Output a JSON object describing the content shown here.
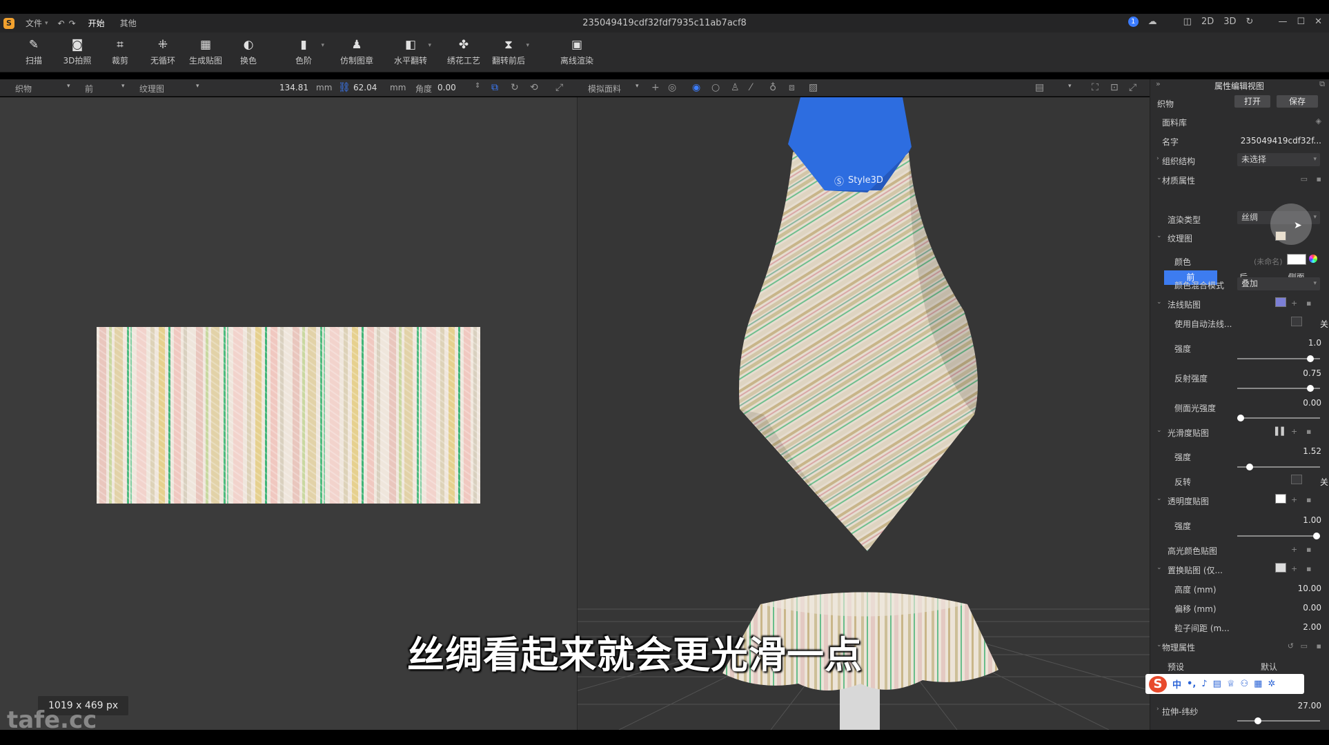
{
  "window": {
    "title": "235049419cdf32fdf7935c11ab7acf8",
    "menus": [
      "文件",
      "开始",
      "其他"
    ],
    "notification_count": "1",
    "view_modes": [
      "2D",
      "3D"
    ]
  },
  "toolbar": {
    "tools": [
      {
        "label": "扫描",
        "icon": "scan-icon"
      },
      {
        "label": "3D拍照",
        "icon": "camera-icon"
      },
      {
        "label": "裁剪",
        "icon": "crop-icon"
      },
      {
        "label": "无循环",
        "icon": "seamless-icon"
      },
      {
        "label": "生成贴图",
        "icon": "generate-map-icon"
      },
      {
        "label": "换色",
        "icon": "color-drop-icon"
      },
      {
        "label": "色阶",
        "icon": "levels-icon"
      },
      {
        "label": "仿制图章",
        "icon": "stamp-icon"
      },
      {
        "label": "水平翻转",
        "icon": "flip-horizontal-icon"
      },
      {
        "label": "绣花工艺",
        "icon": "embroidery-icon"
      },
      {
        "label": "翻转前后",
        "icon": "flip-front-back-icon"
      },
      {
        "label": "离线渲染",
        "icon": "render-icon"
      }
    ]
  },
  "optbar": {
    "object_select": "织物",
    "side_select": "前",
    "map_select": "纹理图",
    "width_value": "134.81",
    "width_unit": "mm",
    "height_value": "62.04",
    "height_unit": "mm",
    "angle_label": "角度",
    "angle_value": "0.00",
    "sim_select": "模拟面料"
  },
  "viewport2d": {
    "size_label": "1019 x 469 px",
    "watermark": "tafe.cc"
  },
  "viewport3d": {
    "brand_label": "Style3D",
    "subtitle": "丝绸看起来就会更光滑一点"
  },
  "panel": {
    "title": "属性编辑视图",
    "fabric_label": "织物",
    "open_button": "打开",
    "save_button": "保存",
    "library_label": "面料库",
    "name_label": "名字",
    "name_value": "235049419cdf32f...",
    "weave_label": "组织结构",
    "weave_value": "未选择",
    "material_label": "材质属性",
    "tabs": [
      "前",
      "后",
      "侧面"
    ],
    "render_type_label": "渲染类型",
    "render_type_value": "丝绸",
    "texture_label": "纹理图",
    "color_label": "颜色",
    "color_value": "(未命名)",
    "blend_label": "颜色混合模式",
    "blend_value": "叠加",
    "normal_label": "法线贴图",
    "auto_normal_label": "使用自动法线...",
    "auto_normal_state": "关",
    "strength_label": "强度",
    "normal_strength": "1.0",
    "reflect_label": "反射强度",
    "reflect_value": "0.75",
    "side_light_label": "侧面光强度",
    "side_light_value": "0.00",
    "gloss_label": "光滑度贴图",
    "gloss_strength": "1.52",
    "invert_label": "反转",
    "invert_state": "关",
    "opacity_label": "透明度贴图",
    "opacity_strength": "1.00",
    "specular_label": "高光颜色贴图",
    "displacement_label": "置换贴图 (仅...",
    "height_label": "高度 (mm)",
    "height_value": "10.00",
    "offset_label": "偏移 (mm)",
    "offset_value": "0.00",
    "particle_label": "粒子间距 (m...",
    "particle_value": "2.00",
    "physics_label": "物理属性",
    "preset_label": "预设",
    "preset_value": "默认",
    "stretch_label": "拉伸-纬纱",
    "stretch_value": "27.00"
  },
  "levels": {
    "normal_strength": 0.88,
    "reflect": 0.88,
    "side_light": 0.04,
    "gloss_strength": 0.15,
    "opacity_strength": 0.96,
    "stretch": 0.25
  },
  "colors": {
    "accent": "#3d7cf0",
    "panel_bg": "#2d2d2e",
    "viewport_bg": "#363636",
    "avatar_blue": "#2d6de0"
  }
}
